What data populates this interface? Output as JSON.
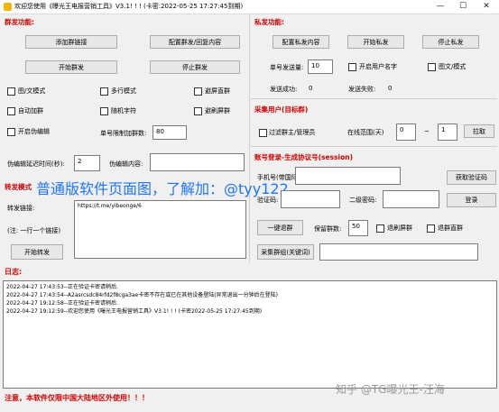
{
  "window": {
    "title": "欢迎您使用《曝光王电报营销工具》V3.1! ! ! (卡密:2022-05-25 17:27:45到期)",
    "minimize": "—",
    "maximize": "☐",
    "close": "✕"
  },
  "group": {
    "section_title": "群发功能:",
    "add_link_btn": "添加群链接",
    "config_btn": "配置群发/回复内容",
    "start_btn": "开始群发",
    "stop_btn": "停止群发",
    "opt_image_text": "图/文模式",
    "opt_multiline": "多行模式",
    "opt_avoid_group": "避屏直群",
    "opt_auto_join": "自动加群",
    "opt_random_char": "随机字符",
    "opt_avoid_screen": "避刷屏群",
    "opt_fake_edit": "开启伪编辑",
    "limit_label": "单号限制加群数:",
    "limit_value": "80",
    "delay_label": "伪编辑延迟时间(秒):",
    "delay_value": "2",
    "edit_content_label": "伪编辑内容:",
    "edit_content_value": ""
  },
  "overlay_text": "普通版软件页面图，了解加：@tyy122",
  "forward": {
    "section_title": "转发模式",
    "link_label": "转发链接:",
    "link_value": "https://t.me/yibeonge/6",
    "note": "(注: 一行一个链接)",
    "start_btn": "开始转发"
  },
  "private": {
    "section_title": "私发功能:",
    "config_btn": "配置私发内容",
    "start_btn": "开始私发",
    "stop_btn": "停止私发",
    "send_count_label": "单号发送量:",
    "send_count_value": "10",
    "opt_username": "开启用户名字",
    "opt_image_text": "图文/模式",
    "success_label": "发送成功:",
    "success_value": "0",
    "fail_label": "发送失败:",
    "fail_value": "0"
  },
  "collect": {
    "section_title": "采集用户(目标群)",
    "opt_filter_admin": "过滤群主/管理员",
    "online_label": "在线范围(天)",
    "range_from": "0",
    "range_sep": "~",
    "range_to": "1",
    "collect_btn": "拉取"
  },
  "account": {
    "section_title": "账号登录-生成协议号(session)",
    "phone_label": "手机号(带国际区号)",
    "phone_value": "",
    "get_code_btn": "获取验证码",
    "code_label": "验证码:",
    "code_value": "",
    "second_pwd_label": "二级密码:",
    "second_pwd_value": "",
    "login_btn": "登录",
    "one_key_btn": "一键退群",
    "keep_label": "保留群数:",
    "keep_value": "50",
    "opt_quit_screen": "退刷屏群",
    "opt_quit_direct": "退群直群",
    "search_btn": "采集群组(关键词)",
    "search_value": ""
  },
  "log": {
    "title": "日志:",
    "lines": [
      "2022-04-27 17:43:53--正在验证卡密请稍后.",
      "2022-04-27 17:43:54--A2asrcsdc84rfd2f8cga3ae卡密不存在或已在其他设备登陆(异常退出一分钟后在登陆)",
      "2022-04-27 19:12:58--正在验证卡密请稍后.",
      "2022-04-27 19:12:59--欢迎您使用《曝光王电报营销工具》V3.1! ! ! (卡密2022-05-25 17:27:45到期)"
    ]
  },
  "footer_note": "注意，本软件仅限中国大陆地区外使用！！！",
  "watermark": "知乎 @TG曝光王-汪海"
}
